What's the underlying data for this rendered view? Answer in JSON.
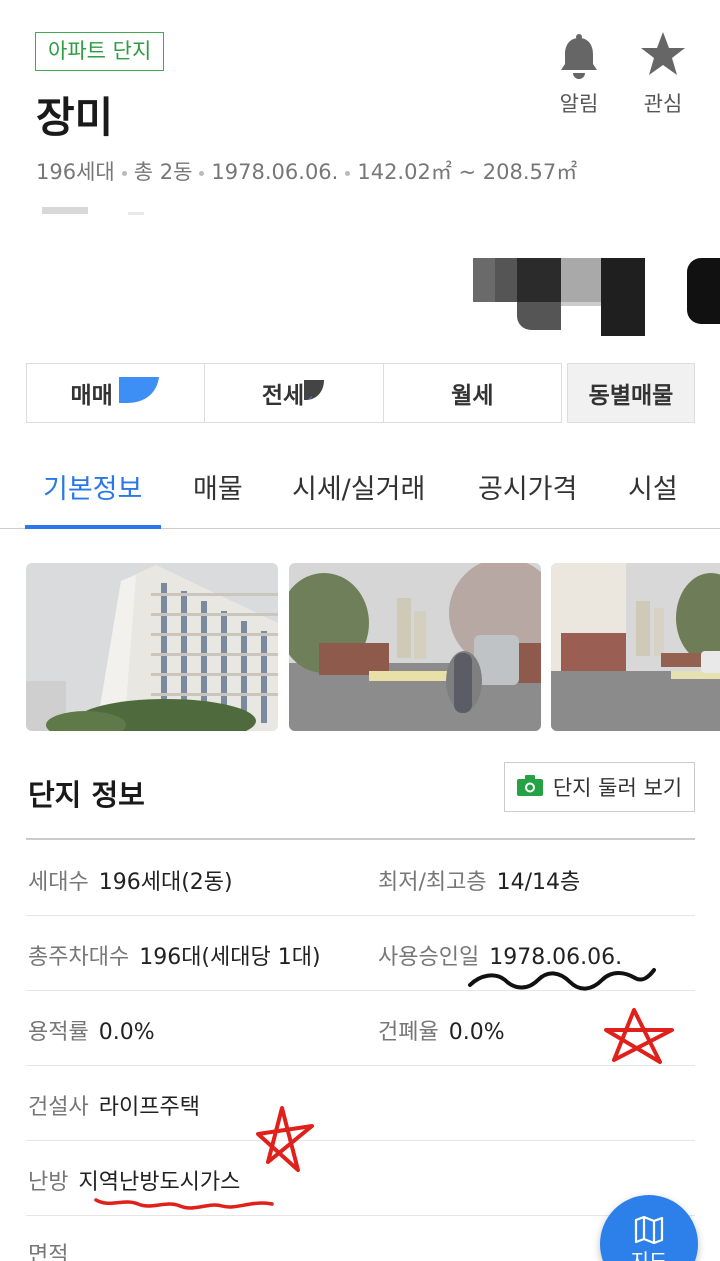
{
  "complex": {
    "tag": "아파트 단지",
    "name": "장미",
    "meta": [
      "196세대",
      "총 2동",
      "1978.06.06.",
      "142.02㎡ ~ 208.57㎡"
    ]
  },
  "actions": {
    "alarm_label": "알림",
    "favorite_label": "관심"
  },
  "deal_types": [
    "매매",
    "전세",
    "월세"
  ],
  "deal_button": "동별매물",
  "tabs": [
    "기본정보",
    "매물",
    "시세/실거래",
    "공시가격",
    "시설"
  ],
  "section": {
    "title": "단지 정보",
    "view_button": "단지 둘러 보기"
  },
  "info": {
    "households": {
      "label": "세대수",
      "value": "196세대(2동)"
    },
    "floors": {
      "label": "최저/최고층",
      "value": "14/14층"
    },
    "parking": {
      "label": "총주차대수",
      "value": "196대(세대당 1대)"
    },
    "approval": {
      "label": "사용승인일",
      "value": "1978.06.06."
    },
    "far": {
      "label": "용적률",
      "value": "0.0%"
    },
    "bcr": {
      "label": "건폐율",
      "value": "0.0%"
    },
    "builder": {
      "label": "건설사",
      "value": "라이프주택"
    },
    "heating": {
      "label": "난방",
      "value": "지역난방도시가스"
    },
    "area": {
      "label": "면적"
    }
  },
  "map_button": "지도",
  "colors": {
    "accent": "#2a78e8",
    "tag_green": "#2d9c43",
    "annotation": "#e0201a"
  }
}
